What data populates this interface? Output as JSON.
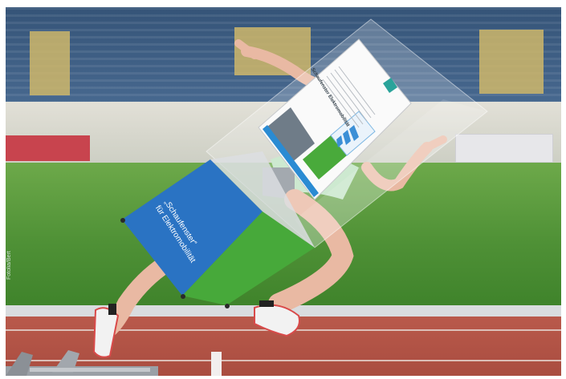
{
  "cube": {
    "line1": "„Schaufenster“",
    "line2": "für Elektromobilität"
  },
  "brochure": {
    "title": "Schaufenster Elektromobilität"
  },
  "photo_credit": "Fotolia/Bert",
  "colors": {
    "cube_blue": "#2a73c3",
    "cube_green": "#47a93a",
    "track_red": "#b0503f",
    "field_green": "#4f9136"
  }
}
